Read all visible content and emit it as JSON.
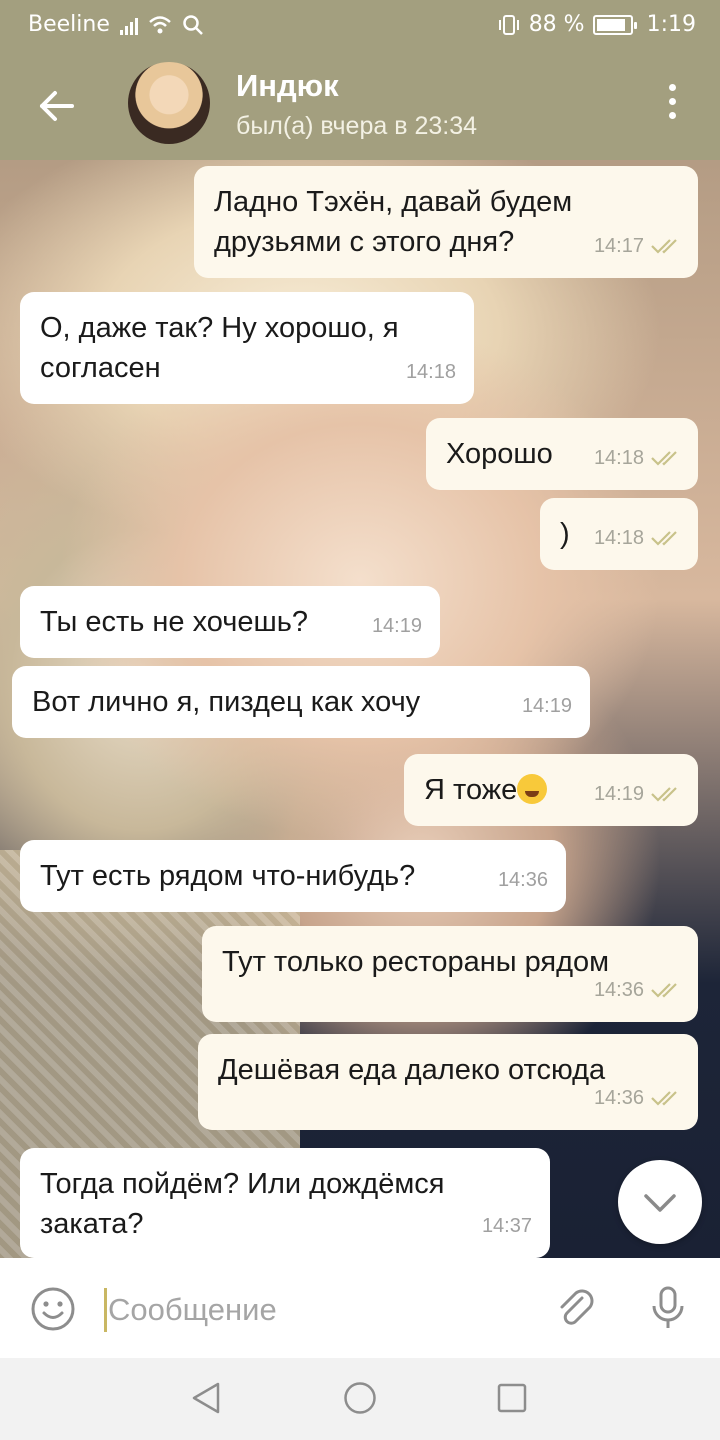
{
  "status_bar": {
    "carrier": "Beeline",
    "battery_percent": "88 %",
    "battery_level": 0.88,
    "time": "1:19"
  },
  "header": {
    "contact_name": "Индюк",
    "last_seen": "был(а) вчера в 23:34",
    "back_icon": "arrow-left-icon",
    "menu_icon": "more-vert-icon"
  },
  "messages": [
    {
      "direction": "out",
      "lines": [
        "Ладно Тэхён, давай будем",
        "друзьями с этого дня?"
      ],
      "time": "14:17",
      "read": true
    },
    {
      "direction": "in",
      "lines": [
        "О, даже так? Ну хорошо, я",
        "согласен"
      ],
      "time": "14:18"
    },
    {
      "direction": "out",
      "lines": [
        "Хорошо"
      ],
      "time": "14:18",
      "read": true
    },
    {
      "direction": "out",
      "lines": [
        ")"
      ],
      "time": "14:18",
      "read": true
    },
    {
      "direction": "in",
      "lines": [
        "Ты есть не хочешь?"
      ],
      "time": "14:19"
    },
    {
      "direction": "in",
      "lines": [
        "Вот лично я, пиздец как хочу"
      ],
      "time": "14:19"
    },
    {
      "direction": "out",
      "lines": [
        "Я тоже"
      ],
      "emoji": "grinning-sweat-emoji",
      "time": "14:19",
      "read": true
    },
    {
      "direction": "in",
      "lines": [
        "Тут есть рядом что-нибудь?"
      ],
      "time": "14:36"
    },
    {
      "direction": "out",
      "lines": [
        "Тут только рестораны рядом"
      ],
      "time": "14:36",
      "read": true
    },
    {
      "direction": "out",
      "lines": [
        "Дешёвая еда далеко отсюда"
      ],
      "time": "14:36",
      "read": true
    },
    {
      "direction": "in",
      "lines": [
        "Тогда пойдём? Или дождёмся",
        "заката?"
      ],
      "time": "14:37"
    }
  ],
  "composer": {
    "placeholder": "Сообщение",
    "emoji_icon": "smile-icon",
    "attach_icon": "paperclip-icon",
    "mic_icon": "microphone-icon"
  },
  "colors": {
    "header": "#a39f7f",
    "outgoing_bubble": "#fdf8ec",
    "incoming_bubble": "#ffffff",
    "read_ticks": "#c8c28a"
  }
}
